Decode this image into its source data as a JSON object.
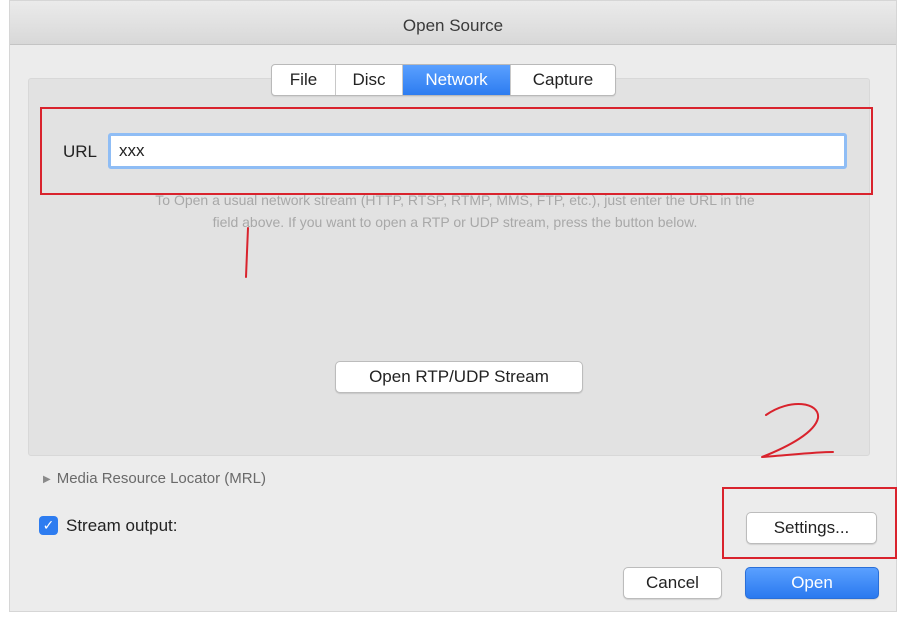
{
  "window": {
    "title": "Open Source"
  },
  "tabs": [
    {
      "label": "File",
      "active": false
    },
    {
      "label": "Disc",
      "active": false
    },
    {
      "label": "Network",
      "active": true
    },
    {
      "label": "Capture",
      "active": false
    }
  ],
  "url": {
    "label": "URL",
    "value": "xxx"
  },
  "hint": {
    "line1": "To Open a usual network stream (HTTP, RTSP, RTMP, MMS, FTP, etc.), just enter the URL in the",
    "line2": "field above. If you want to open a RTP or UDP stream, press the button below."
  },
  "buttons": {
    "rtp_udp": "Open RTP/UDP Stream",
    "settings": "Settings...",
    "cancel": "Cancel",
    "open": "Open"
  },
  "mrl": {
    "label": "Media Resource Locator (MRL)",
    "expanded": false
  },
  "stream_output": {
    "label": "Stream output:",
    "checked": true
  },
  "colors": {
    "accent": "#2d7cf0",
    "annotation": "#d9232d"
  }
}
